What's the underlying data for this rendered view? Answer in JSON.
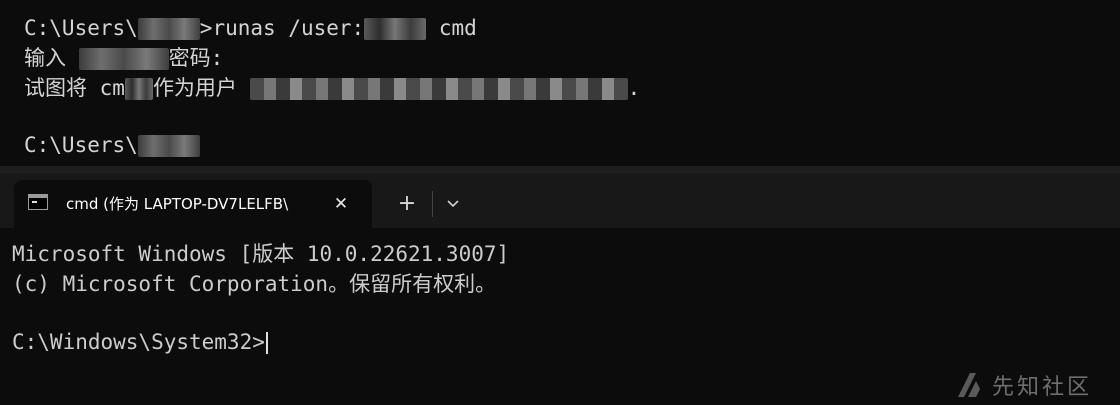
{
  "background_terminal": {
    "line1": {
      "prefix": "C:\\Users\\",
      "middle": ">runas /user:",
      "suffix": " cmd"
    },
    "line2": {
      "prefix": "输入 ",
      "suffix": "密码:"
    },
    "line3": {
      "prefix": "试图将 cm",
      "mid": "作为用户 ",
      "suffix": "."
    },
    "line4": {
      "prefix": "C:\\Users\\"
    }
  },
  "tab": {
    "title": "cmd (作为 LAPTOP-DV7LELFB\\",
    "close_glyph": "✕",
    "new_tab_glyph": "+"
  },
  "terminal": {
    "lines": [
      "Microsoft Windows [版本 10.0.22621.3007]",
      "(c) Microsoft Corporation。保留所有权利。",
      "",
      "C:\\Windows\\System32>"
    ]
  },
  "watermark": {
    "text": "先知社区"
  },
  "colors": {
    "terminal_bg": "#0c0c0c",
    "tabbar_bg": "#181818",
    "text": "#cccccc"
  }
}
